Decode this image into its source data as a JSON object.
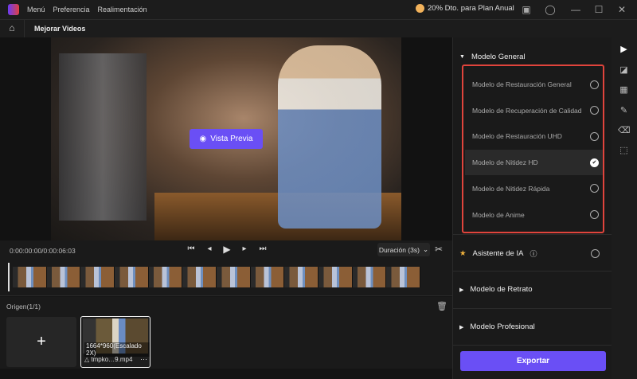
{
  "titlebar": {
    "menus": [
      "Menú",
      "Preferencia",
      "Realimentación"
    ],
    "promo": "20% Dto. para Plan Anual"
  },
  "toolbar": {
    "title": "Mejorar Videos"
  },
  "preview": {
    "button": "Vista Previa"
  },
  "controls": {
    "time": "0:00:00:00/0:00:06:03",
    "duration": "Duración (3s)"
  },
  "origin": {
    "label": "Origen(1/1)",
    "clip": {
      "resolution": "1664*960(Escalado 2X)",
      "name": "tmpko…9.mp4"
    }
  },
  "panel": {
    "general": {
      "title": "Modelo General",
      "options": [
        {
          "label": "Modelo de Restauración General",
          "selected": false
        },
        {
          "label": "Modelo de Recuperación de Calidad",
          "selected": false
        },
        {
          "label": "Modelo de Restauración UHD",
          "selected": false
        },
        {
          "label": "Modelo de Nitidez HD",
          "selected": true
        },
        {
          "label": "Modelo de Nitidez Rápida",
          "selected": false
        },
        {
          "label": "Modelo de Anime",
          "selected": false
        }
      ]
    },
    "ai": "Asistente de IA",
    "portrait": "Modelo de Retrato",
    "pro": "Modelo Profesional",
    "export": "Exportar"
  },
  "colors": {
    "accent": "#6a4ff5",
    "highlight": "#e0443c"
  }
}
